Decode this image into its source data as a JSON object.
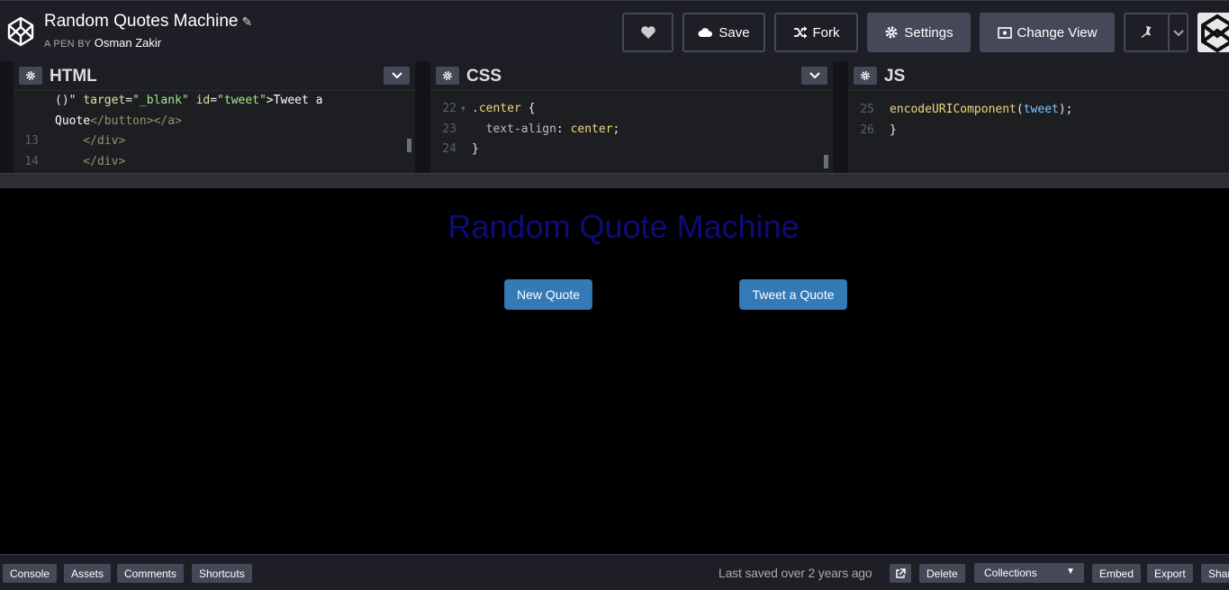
{
  "header": {
    "title": "Random Quotes Machine",
    "byline_prefix": "A PEN BY",
    "author": "Osman Zakir",
    "buttons": {
      "save": "Save",
      "fork": "Fork",
      "settings": "Settings",
      "change_view": "Change View"
    }
  },
  "editors": {
    "html": {
      "title": "HTML",
      "lines": [
        {
          "num": "",
          "segments": [
            {
              "text": "()\" ",
              "color": "#e8e8e8"
            },
            {
              "text": "target",
              "color": "#dde39f"
            },
            {
              "text": "=",
              "color": "#e8e8e8"
            },
            {
              "text": "\"_blank\"",
              "color": "#a5e887"
            },
            {
              "text": " ",
              "color": "#e8e8e8"
            },
            {
              "text": "id",
              "color": "#dde39f"
            },
            {
              "text": "=",
              "color": "#e8e8e8"
            },
            {
              "text": "\"tweet\"",
              "color": "#a5e887"
            },
            {
              "text": ">Tweet a",
              "color": "#ffffff"
            }
          ]
        },
        {
          "num": "",
          "segments": [
            {
              "text": "Quote",
              "color": "#ffffff"
            },
            {
              "text": "</button></a>",
              "color": "#9b8f6a"
            }
          ]
        },
        {
          "num": "13",
          "segments": [
            {
              "text": "    </div>",
              "color": "#9b8f6a"
            }
          ]
        },
        {
          "num": "14",
          "segments": [
            {
              "text": "    </div>",
              "color": "#9b8f6a"
            }
          ]
        }
      ]
    },
    "css": {
      "title": "CSS",
      "lines": [
        {
          "num": "22",
          "fold": true,
          "segments": [
            {
              "text": ".center ",
              "color": "#f0d77b"
            },
            {
              "text": "{",
              "color": "#e8e8e8"
            }
          ]
        },
        {
          "num": "23",
          "segments": [
            {
              "text": "  text-align",
              "color": "#bdbdbd"
            },
            {
              "text": ": ",
              "color": "#e8e8e8"
            },
            {
              "text": "center",
              "color": "#f0d77b"
            },
            {
              "text": ";",
              "color": "#e8e8e8"
            }
          ]
        },
        {
          "num": "24",
          "segments": [
            {
              "text": "}",
              "color": "#e8e8e8"
            }
          ]
        }
      ]
    },
    "js": {
      "title": "JS",
      "lines": [
        {
          "num": "25",
          "segments": [
            {
              "text": "encodeURIComponent",
              "color": "#f0d77b"
            },
            {
              "text": "(",
              "color": "#e8e8e8"
            },
            {
              "text": "tweet",
              "color": "#7dc6ff"
            },
            {
              "text": ");",
              "color": "#e8e8e8"
            }
          ]
        },
        {
          "num": "26",
          "segments": [
            {
              "text": "}",
              "color": "#e8e8e8"
            }
          ]
        }
      ]
    }
  },
  "preview": {
    "heading": "Random Quote Machine",
    "new_quote": "New Quote",
    "tweet_quote": "Tweet a Quote"
  },
  "footer": {
    "console": "Console",
    "assets": "Assets",
    "comments": "Comments",
    "shortcuts": "Shortcuts",
    "last_saved": "Last saved over 2 years ago",
    "delete": "Delete",
    "collections": "Collections",
    "embed": "Embed",
    "export": "Export",
    "share": "Shar"
  }
}
